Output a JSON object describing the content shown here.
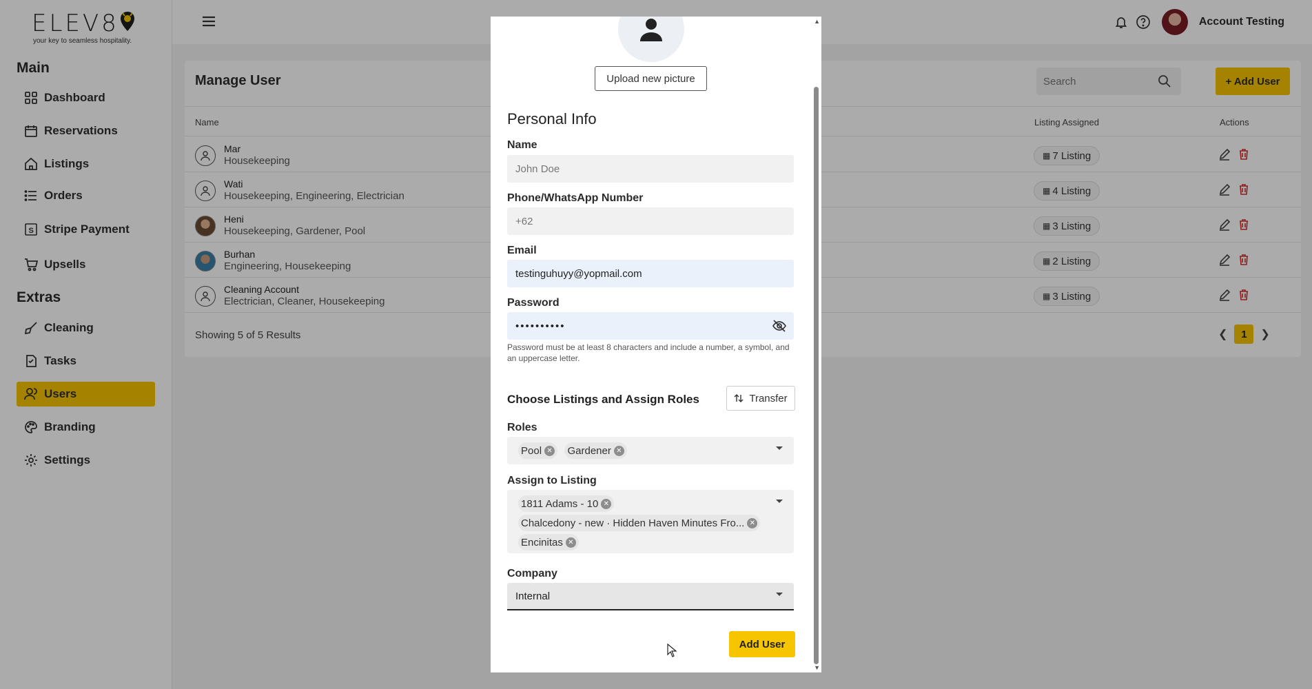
{
  "brand": {
    "name": "ELEV8",
    "tagline": "your key to seamless hospitality."
  },
  "sidebar": {
    "sections": [
      "Main",
      "Extras"
    ],
    "main_items": [
      {
        "label": "Dashboard",
        "icon": "dashboard-icon"
      },
      {
        "label": "Reservations",
        "icon": "calendar-icon"
      },
      {
        "label": "Listings",
        "icon": "home-icon"
      },
      {
        "label": "Orders",
        "icon": "list-icon"
      },
      {
        "label": "Stripe Payment",
        "icon": "stripe-icon"
      },
      {
        "label": "Upsells",
        "icon": "cart-icon"
      }
    ],
    "extras_items": [
      {
        "label": "Cleaning",
        "icon": "broom-icon"
      },
      {
        "label": "Tasks",
        "icon": "task-icon"
      },
      {
        "label": "Users",
        "icon": "users-icon",
        "active": true
      },
      {
        "label": "Branding",
        "icon": "palette-icon"
      },
      {
        "label": "Settings",
        "icon": "gear-icon"
      }
    ]
  },
  "topbar": {
    "account_name": "Account Testing"
  },
  "page": {
    "title": "Manage User",
    "search_placeholder": "Search",
    "add_button": "+ Add User",
    "columns": {
      "name": "Name",
      "listing": "Listing Assigned",
      "actions": "Actions"
    },
    "rows": [
      {
        "name": "Mar",
        "roles": "Housekeeping",
        "listing": "7 Listing"
      },
      {
        "name": "Wati",
        "roles": "Housekeeping, Engineering, Electrician",
        "listing": "4 Listing"
      },
      {
        "name": "Heni",
        "roles": "Housekeeping, Gardener, Pool",
        "listing": "3 Listing"
      },
      {
        "name": "Burhan",
        "roles": "Engineering, Housekeeping",
        "listing": "2 Listing"
      },
      {
        "name": "Cleaning Account",
        "roles": "Electrician, Cleaner, Housekeeping",
        "listing": "3 Listing"
      }
    ],
    "results_text": "Showing 5 of 5 Results",
    "current_page": "1"
  },
  "modal": {
    "upload_label": "Upload new picture",
    "section_title": "Personal Info",
    "name_label": "Name",
    "name_placeholder": "John Doe",
    "phone_label": "Phone/WhatsApp Number",
    "phone_placeholder": "+62",
    "email_label": "Email",
    "email_value": "testinguhuyy@yopmail.com",
    "password_label": "Password",
    "password_value": "••••••••••",
    "password_hint": "Password must be at least 8 characters and include a number, a symbol, and an uppercase letter.",
    "assign_title": "Choose Listings and Assign Roles",
    "transfer_label": "Transfer",
    "roles_label": "Roles",
    "roles": [
      "Pool",
      "Gardener"
    ],
    "listing_label": "Assign to Listing",
    "listings": [
      "1811 Adams - 10",
      "Chalcedony - new · Hidden Haven Minutes Fro...",
      "Encinitas"
    ],
    "company_label": "Company",
    "company_value": "Internal",
    "submit_label": "Add User"
  }
}
